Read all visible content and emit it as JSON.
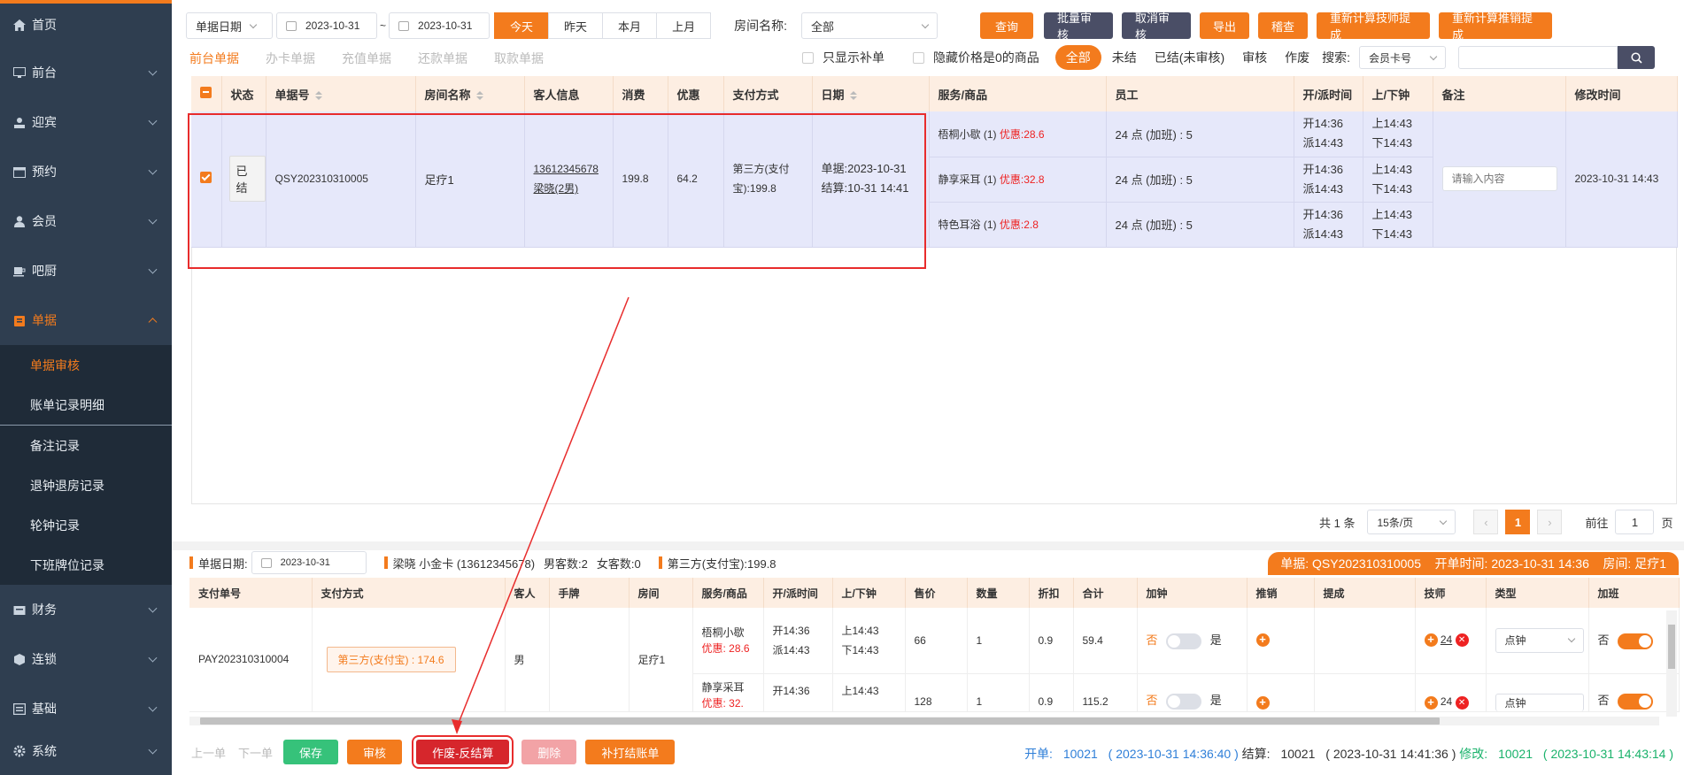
{
  "sidebar": {
    "items": [
      {
        "label": "首页",
        "icon": "home-icon"
      },
      {
        "label": "前台",
        "icon": "monitor-icon"
      },
      {
        "label": "迎宾",
        "icon": "user-desk-icon"
      },
      {
        "label": "预约",
        "icon": "calendar-icon"
      },
      {
        "label": "会员",
        "icon": "user-icon"
      },
      {
        "label": "吧厨",
        "icon": "cup-icon"
      },
      {
        "label": "单据",
        "icon": "receipt-icon"
      }
    ],
    "sub_items": [
      "单据审核",
      "账单记录明细",
      "备注记录",
      "退钟退房记录",
      "轮钟记录",
      "下班牌位记录"
    ],
    "bottom_items": [
      {
        "label": "财务",
        "icon": "finance-icon"
      },
      {
        "label": "连锁",
        "icon": "cube-icon"
      },
      {
        "label": "基础",
        "icon": "base-icon"
      },
      {
        "label": "系统",
        "icon": "gear-icon"
      }
    ]
  },
  "toolbar": {
    "date_type": "单据日期",
    "date_from": "2023-10-31",
    "date_sep": "~",
    "date_to": "2023-10-31",
    "range_btns": [
      "今天",
      "昨天",
      "本月",
      "上月"
    ],
    "room_label": "房间名称:",
    "room_value": "全部",
    "query": "查询",
    "batch_audit": "批量审核",
    "cancel_audit": "取消审核",
    "export": "导出",
    "check": "稽查",
    "recalc_tech": "重新计算技师提成",
    "recalc_sales": "重新计算推销提成"
  },
  "tabs": [
    "前台单据",
    "办卡单据",
    "充值单据",
    "还款单据",
    "取款单据"
  ],
  "filters": {
    "only_supplement": "只显示补单",
    "hide_zero": "隐藏价格是0的商品",
    "all": "全部",
    "unsettled": "未结",
    "settled_unaudited": "已结(未审核)",
    "audited": "审核",
    "void": "作废",
    "search_label": "搜索:",
    "search_type": "会员卡号"
  },
  "table1": {
    "headers": [
      "状态",
      "单据号",
      "房间名称",
      "客人信息",
      "消费",
      "优惠",
      "支付方式",
      "日期",
      "服务/商品",
      "员工",
      "开/派时间",
      "上/下钟",
      "备注",
      "修改时间"
    ],
    "row": {
      "status": "已结",
      "bill_no": "QSY202310310005",
      "room": "足疗1",
      "guest_phone": "13612345678",
      "guest_name": "梁晓(2男)",
      "consume": "199.8",
      "discount": "64.2",
      "pay1": "第三方(支付",
      "pay2": "宝):199.8",
      "date1": "单据:2023-10-31",
      "date2": "结算:10-31 14:41",
      "remark_placeholder": "请输入内容",
      "modify_time": "2023-10-31 14:43",
      "services": [
        {
          "name": "梧桐小歇 (1)",
          "promo": "优惠:28.6",
          "staff": "24 点 (加班) : 5",
          "open": "开14:36",
          "dispatch": "派14:43",
          "up": "上14:43",
          "down": "下14:43"
        },
        {
          "name": "静享采耳 (1)",
          "promo": "优惠:32.8",
          "staff": "24 点 (加班) : 5",
          "open": "开14:36",
          "dispatch": "派14:43",
          "up": "上14:43",
          "down": "下14:43"
        },
        {
          "name": "特色耳浴 (1)",
          "promo": "优惠:2.8",
          "staff": "24 点 (加班) : 5",
          "open": "开14:36",
          "dispatch": "派14:43",
          "up": "上14:43",
          "down": "下14:43"
        }
      ]
    }
  },
  "pager": {
    "total": "共 1 条",
    "per_page": "15条/页",
    "current": "1",
    "goto_label": "前往",
    "goto_value": "1",
    "page_unit": "页"
  },
  "detail": {
    "date_label": "单据日期:",
    "date_value": "2023-10-31",
    "member": "梁晓 小金卡 (13612345678)",
    "male": "男客数:2",
    "female": "女客数:0",
    "pay": "第三方(支付宝):199.8",
    "badge": "单据: QSY202310310005    开单时间: 2023-10-31 14:36    房间: 足疗1",
    "headers": [
      "支付单号",
      "支付方式",
      "客人",
      "手牌",
      "房间",
      "服务/商品",
      "开/派时间",
      "上/下钟",
      "售价",
      "数量",
      "折扣",
      "合计",
      "加钟",
      "推销",
      "提成",
      "技师",
      "类型",
      "加班"
    ],
    "pay_no": "PAY202310310004",
    "pay_tag": "第三方(支付宝) : 174.6",
    "guest": "男",
    "room": "足疗1",
    "rows": [
      {
        "service": "梧桐小歇",
        "promo": "优惠: 28.6",
        "open": "开14:36",
        "dispatch": "派14:43",
        "up": "上14:43",
        "down": "下14:43",
        "price": "66",
        "qty": "1",
        "disc": "0.9",
        "total": "59.4",
        "no": "否",
        "yes": "是",
        "tech": "24",
        "type": "点钟",
        "ot_no": "否"
      },
      {
        "service": "静享采耳",
        "promo": "优惠: 32.",
        "open": "开14:36",
        "dispatch": "",
        "up": "上14:43",
        "down": "",
        "price": "128",
        "qty": "1",
        "disc": "0.9",
        "total": "115.2",
        "no": "否",
        "yes": "是",
        "tech": "24",
        "type": "点钟",
        "ot_no": "否"
      }
    ]
  },
  "bottom": {
    "prev": "上一单",
    "next": "下一单",
    "save": "保存",
    "audit": "审核",
    "void_reverse": "作废-反结算",
    "delete": "删除",
    "reprint": "补打结账单"
  },
  "info": {
    "open_label": "开单:",
    "open_user": "10021",
    "open_time": "( 2023-10-31 14:36:40 )",
    "settle_label": "结算:",
    "settle_user": "10021",
    "settle_time": "( 2023-10-31 14:41:36 )",
    "modify_label": "修改:",
    "modify_user": "10021",
    "modify_time": "( 2023-10-31 14:43:14 )"
  }
}
